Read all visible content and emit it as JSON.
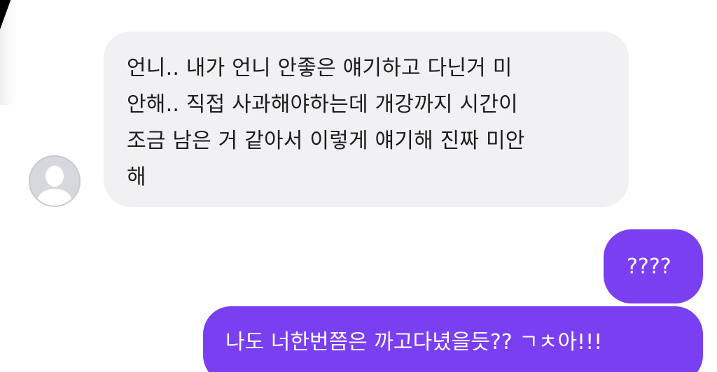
{
  "conversation": {
    "incoming": {
      "avatar_icon": "default-user-avatar-icon",
      "lines": [
        "언니.. 내가 언니 안좋은 얘기하고 다닌거 미",
        "안해.. 직접 사과해야하는데 개강까지 시간이",
        "조금 남은 거 같아서 이렇게 얘기해 진짜 미안",
        "해"
      ]
    },
    "outgoing": [
      {
        "text": "????"
      },
      {
        "text": "나도 너한번쯤은 까고다녔을듯?? ㄱㅊ아!!!"
      }
    ]
  },
  "colors": {
    "incoming_bubble": "#f1f1f4",
    "outgoing_bubble": "#7b3ff2",
    "avatar_bg": "#d7d8dd"
  }
}
